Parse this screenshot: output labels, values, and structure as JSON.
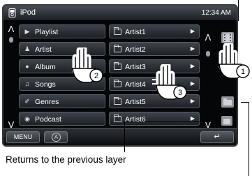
{
  "header": {
    "source_title": "iPod",
    "clock": "12:34 AM",
    "source_icon": "ipod-icon"
  },
  "categories": [
    {
      "label": "Playlist",
      "icon": "playlist-icon",
      "glyph": "▶"
    },
    {
      "label": "Artist",
      "icon": "artist-icon",
      "glyph": "♟"
    },
    {
      "label": "Album",
      "icon": "album-icon",
      "glyph": "●"
    },
    {
      "label": "Songs",
      "icon": "songs-icon",
      "glyph": "♫"
    },
    {
      "label": "Genres",
      "icon": "genres-icon",
      "glyph": "✐"
    },
    {
      "label": "Podcast",
      "icon": "podcast-icon",
      "glyph": "◉"
    }
  ],
  "items": [
    {
      "label": "Artist1"
    },
    {
      "label": "Artist2"
    },
    {
      "label": "Artist3"
    },
    {
      "label": "Artist4"
    },
    {
      "label": "Artist5"
    },
    {
      "label": "Artist6"
    }
  ],
  "nav": {
    "up": "Λ",
    "down": "V",
    "arrow": "▶"
  },
  "bottom": {
    "menu_label": "MENU",
    "a_label": "A",
    "back_glyph": "↵"
  },
  "steps": [
    "1",
    "2",
    "3"
  ],
  "caption": "Returns to the previous layer"
}
